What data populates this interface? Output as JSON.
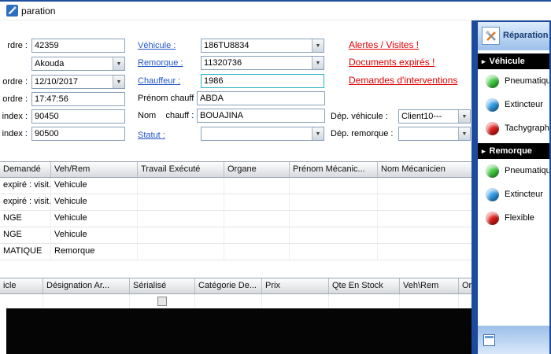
{
  "window": {
    "title": "paration"
  },
  "form": {
    "num_ordre": {
      "label": "rdre :",
      "value": "42359"
    },
    "agence": {
      "value": "Akouda"
    },
    "date_ordre": {
      "label": "ordre :",
      "value": "12/10/2017"
    },
    "heure_ordre": {
      "label": "ordre :",
      "value": "17:47:56"
    },
    "index1": {
      "label": "er index :",
      "value": "90450"
    },
    "index2": {
      "label": "eau index :",
      "value": "90500"
    },
    "vehicule": {
      "label": "Véhicule :",
      "value": "186TU8834"
    },
    "remorque": {
      "label": "Remorque :",
      "value": "11320736"
    },
    "chauffeur": {
      "label": "Chauffeur :",
      "value": "1986"
    },
    "prenom_chauff": {
      "label": "Prénom chauff :",
      "value": "ABDA"
    },
    "nom_chauff": {
      "label": "Nom    chauff :",
      "value": "BOUAJINA"
    },
    "statut": {
      "label": "Statut :",
      "value": ""
    },
    "dep_vehicule": {
      "label": "Dép. véhicule :",
      "value": "Client10---"
    },
    "dep_remorque": {
      "label": "Dép. remorque :",
      "value": ""
    },
    "alerts": [
      "Alertes / Visites !",
      "Documents expirés !",
      "Demandes d'interventions"
    ]
  },
  "grid1": {
    "columns": [
      "Demandé",
      "Veh/Rem",
      "Travail Exécuté",
      "Organe",
      "Prénom Mécanic...",
      "Nom Mécanicien"
    ],
    "rows": [
      [
        "expiré : visit...",
        "Vehicule",
        "",
        "",
        "",
        ""
      ],
      [
        "expiré : visit...",
        "Vehicule",
        "",
        "",
        "",
        ""
      ],
      [
        "NGE",
        "Vehicule",
        "",
        "",
        "",
        ""
      ],
      [
        "NGE",
        "Vehicule",
        "",
        "",
        "",
        ""
      ],
      [
        "MATIQUE",
        "Remorque",
        "",
        "",
        "",
        ""
      ]
    ]
  },
  "grid2": {
    "columns": [
      "icle",
      "Désignation Ar...",
      "Sérialisé",
      "Catégorie De...",
      "Prix",
      "Qte En Stock",
      "Veh\\Rem",
      "Or..."
    ],
    "rows": [
      [
        "",
        "",
        "",
        "",
        "",
        "",
        "",
        ""
      ]
    ]
  },
  "sidebar": {
    "title": "Réparation",
    "sections": [
      {
        "title": "Véhicule",
        "items": [
          {
            "label": "Pneumatique",
            "color": "#3ecb3e"
          },
          {
            "label": "Extincteur",
            "color": "#2e9be6"
          },
          {
            "label": "Tachygraphe",
            "color": "#df1a1a"
          }
        ]
      },
      {
        "title": "Remorque",
        "items": [
          {
            "label": "Pneumatique",
            "color": "#3ecb3e"
          },
          {
            "label": "Extincteur",
            "color": "#2e9be6"
          },
          {
            "label": "Flexible",
            "color": "#df1a1a"
          }
        ]
      }
    ]
  }
}
